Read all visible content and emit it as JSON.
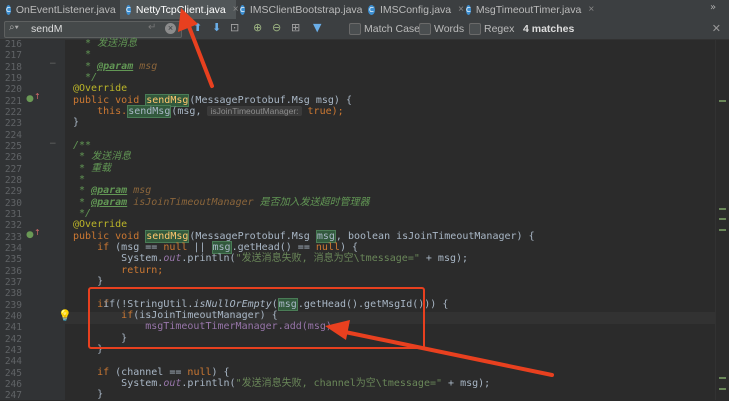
{
  "tabs": [
    {
      "label": "OnEventListener.java",
      "active": false
    },
    {
      "label": "NettyTcpClient.java",
      "active": true
    },
    {
      "label": "IMSClientBootstrap.java",
      "active": false
    },
    {
      "label": "IMSConfig.java",
      "active": false
    },
    {
      "label": "MsgTimeoutTimer.java",
      "active": false
    }
  ],
  "tab_icon_glyph": "C",
  "tab_close_glyph": "×",
  "tab_overflow": "»",
  "search": {
    "value": "sendM",
    "match_case": "Match Case",
    "words": "Words",
    "regex": "Regex",
    "matches": "4 matches"
  },
  "lines": [
    {
      "n": "216"
    },
    {
      "n": "217"
    },
    {
      "n": "218"
    },
    {
      "n": "219"
    },
    {
      "n": "220"
    },
    {
      "n": "221"
    },
    {
      "n": "222"
    },
    {
      "n": "223"
    },
    {
      "n": "224"
    },
    {
      "n": "225"
    },
    {
      "n": "226"
    },
    {
      "n": "227"
    },
    {
      "n": "228"
    },
    {
      "n": "229"
    },
    {
      "n": "230"
    },
    {
      "n": "231"
    },
    {
      "n": "232"
    },
    {
      "n": "233"
    },
    {
      "n": "234"
    },
    {
      "n": "235"
    },
    {
      "n": "236"
    },
    {
      "n": "237"
    },
    {
      "n": "238"
    },
    {
      "n": "239"
    },
    {
      "n": "240"
    },
    {
      "n": "241"
    },
    {
      "n": "242"
    },
    {
      "n": "243"
    },
    {
      "n": "244"
    },
    {
      "n": "245"
    },
    {
      "n": "246"
    },
    {
      "n": "247"
    }
  ],
  "code": {
    "l216": "* 发送消息",
    "l217": "*",
    "l218_tag": "@param",
    "l218_param": "msg",
    "l219": "*/",
    "override": "@Override",
    "l221_pre": "public void ",
    "l221_m": "sendMsg",
    "l221_post": "(MessageProtobuf.Msg msg) {",
    "l222_pre": "this.",
    "l222_m": "sendMsg",
    "l222_mid": "(msg, ",
    "l222_hint": "isJoinTimeoutManager:",
    "l222_post": " true);",
    "l223": "}",
    "l225": "/**",
    "l226": "* 发送消息",
    "l227": "* 重载",
    "l228": "*",
    "l229_tag": "@param",
    "l229_param": "msg",
    "l230_tag": "@param",
    "l230_param": "isJoinTimeoutManager",
    "l230_text": " 是否加入发送超时管理器",
    "l231": "*/",
    "l233_pre": "public void ",
    "l233_m": "sendMsg",
    "l233_post": "(MessageProtobuf.Msg ",
    "l233_msg": "msg",
    "l233_end": ", boolean isJoinTimeoutManager) {",
    "l234_kw": "if",
    "l234_a": " (msg == ",
    "l234_null": "null",
    "l234_b": " || ",
    "l234_msg": "msg",
    "l234_c": ".getHead() == ",
    "l234_d": ") {",
    "sys": "System.",
    "out": "out",
    "println": ".println(",
    "l235_str": "\"发送消息失败, 消息为空\\tmessage=\"",
    "plus_msg": " + msg);",
    "l236_kw": "return",
    "semi": ";",
    "rbrace": "}",
    "l239_a": "if(!StringUtil.",
    "l239_m": "isNullOrEmpty",
    "l239_b": "(",
    "l239_msg": "msg",
    "l239_c": ".getHead().getMsgId())) {",
    "l240_kw": "if",
    "l240_rest": "(isJoinTimeoutManager) {",
    "l241": "msgTimeoutTimerManager.add(msg);",
    "l245_kw": "if",
    "l245_a": " (channel == ",
    "l245_b": ") {",
    "l246_str": "\"发送消息失败, channel为空\\tmessage=\"",
    "null": "null"
  },
  "colors": {
    "annotation_red": "#e8401f",
    "match_highlight": "#32593d"
  }
}
